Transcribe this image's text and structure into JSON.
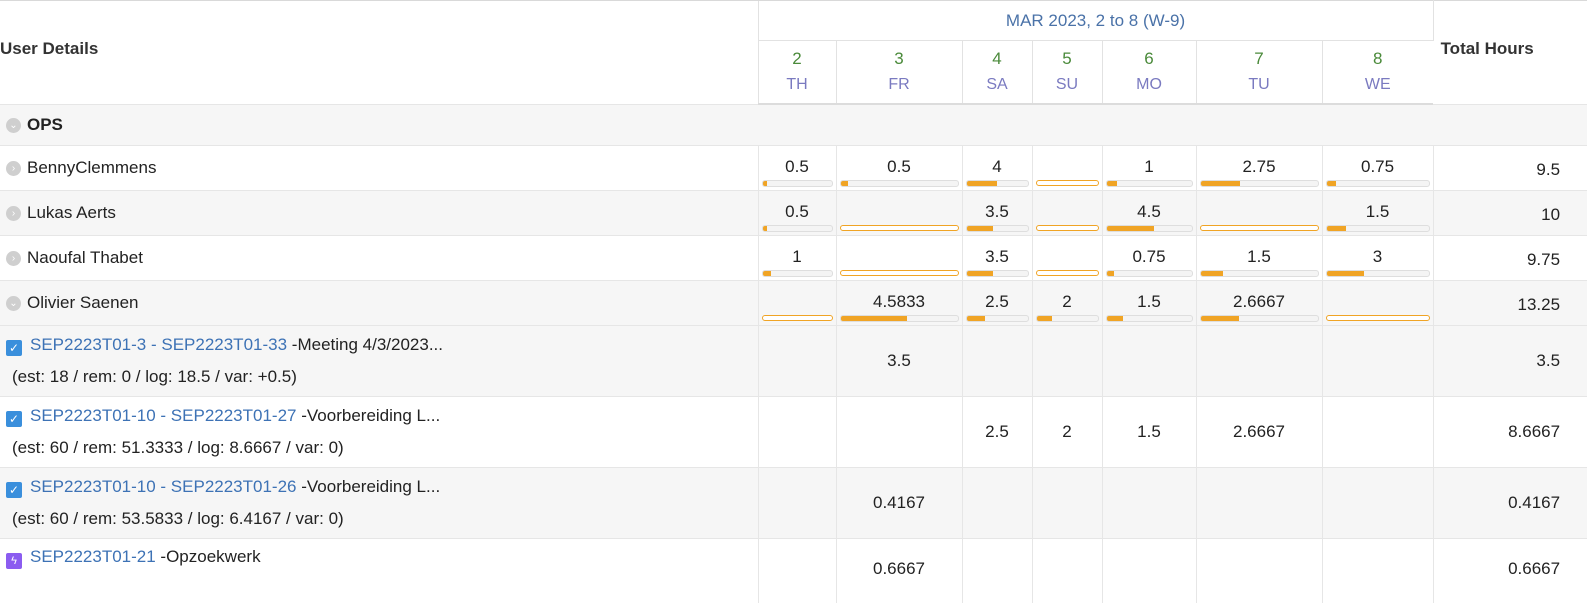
{
  "header": {
    "user_details": "User Details",
    "month": "MAR 2023, 2 to 8 (W-9)",
    "total_hours": "Total Hours",
    "days": [
      {
        "num": "2",
        "dow": "TH"
      },
      {
        "num": "3",
        "dow": "FR"
      },
      {
        "num": "4",
        "dow": "SA"
      },
      {
        "num": "5",
        "dow": "SU"
      },
      {
        "num": "6",
        "dow": "MO"
      },
      {
        "num": "7",
        "dow": "TU"
      },
      {
        "num": "8",
        "dow": "WE"
      }
    ]
  },
  "group": {
    "name": "OPS"
  },
  "users": [
    {
      "name": "BennyClemmens",
      "total": "9.5",
      "cells": [
        {
          "v": "0.5",
          "p": 0.06
        },
        {
          "v": "0.5",
          "p": 0.06
        },
        {
          "v": "4",
          "p": 0.5
        },
        {
          "v": "",
          "p": 0
        },
        {
          "v": "1",
          "p": 0.12
        },
        {
          "v": "2.75",
          "p": 0.34
        },
        {
          "v": "0.75",
          "p": 0.09
        }
      ]
    },
    {
      "name": "Lukas Aerts",
      "total": "10",
      "cells": [
        {
          "v": "0.5",
          "p": 0.06
        },
        {
          "v": "",
          "p": 0
        },
        {
          "v": "3.5",
          "p": 0.44
        },
        {
          "v": "",
          "p": 0
        },
        {
          "v": "4.5",
          "p": 0.56
        },
        {
          "v": "",
          "p": 0
        },
        {
          "v": "1.5",
          "p": 0.19
        }
      ]
    },
    {
      "name": "Naoufal Thabet",
      "total": "9.75",
      "cells": [
        {
          "v": "1",
          "p": 0.12
        },
        {
          "v": "",
          "p": 0
        },
        {
          "v": "3.5",
          "p": 0.44
        },
        {
          "v": "",
          "p": 0
        },
        {
          "v": "0.75",
          "p": 0.09
        },
        {
          "v": "1.5",
          "p": 0.19
        },
        {
          "v": "3",
          "p": 0.37
        }
      ]
    },
    {
      "name": "Olivier Saenen",
      "total": "13.25",
      "cells": [
        {
          "v": "",
          "p": 0
        },
        {
          "v": "4.5833",
          "p": 0.57
        },
        {
          "v": "2.5",
          "p": 0.31
        },
        {
          "v": "2",
          "p": 0.25
        },
        {
          "v": "1.5",
          "p": 0.19
        },
        {
          "v": "2.6667",
          "p": 0.33
        },
        {
          "v": "",
          "p": 0
        }
      ]
    }
  ],
  "tasks": [
    {
      "link": "SEP2223T01-3 - SEP2223T01-33",
      "desc": " -Meeting 4/3/2023...",
      "meta": "(est: 18 / rem: 0 / log: 18.5 / var: +0.5)",
      "cells": [
        "",
        "3.5",
        "",
        "",
        "",
        "",
        ""
      ],
      "total": "3.5",
      "icon": "checkbox"
    },
    {
      "link": "SEP2223T01-10 - SEP2223T01-27",
      "desc": " -Voorbereiding L...",
      "meta": "(est: 60 / rem: 51.3333 / log: 8.6667 / var: 0)",
      "cells": [
        "",
        "",
        "2.5",
        "2",
        "1.5",
        "2.6667",
        ""
      ],
      "total": "8.6667",
      "icon": "checkbox"
    },
    {
      "link": "SEP2223T01-10 - SEP2223T01-26",
      "desc": " -Voorbereiding L...",
      "meta": "(est: 60 / rem: 53.5833 / log: 6.4167 / var: 0)",
      "cells": [
        "",
        "0.4167",
        "",
        "",
        "",
        "",
        ""
      ],
      "total": "0.4167",
      "icon": "checkbox"
    },
    {
      "link": "SEP2223T01-21",
      "desc": " -Opzoekwerk",
      "meta": "",
      "cells": [
        "",
        "0.6667",
        "",
        "",
        "",
        "",
        ""
      ],
      "total": "0.6667",
      "icon": "bolt"
    }
  ],
  "colors": {
    "accent": "#f0a425",
    "link": "#3d72b5",
    "day_num": "#4a8a3a",
    "day_dow": "#7a7ac0",
    "bolt": "#8b5cf0",
    "checkbox": "#3a8fdc"
  }
}
